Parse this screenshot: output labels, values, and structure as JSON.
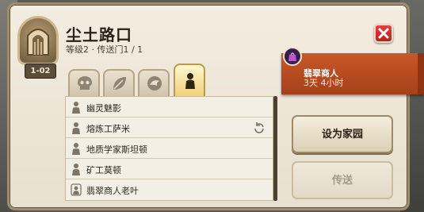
{
  "header": {
    "title": "尘土路口",
    "subtitle": "等级2 · 传送门1 / 1",
    "level_badge": "1-02"
  },
  "tabs": [
    {
      "icon": "skull-icon",
      "active": false
    },
    {
      "icon": "leaf-icon",
      "active": false
    },
    {
      "icon": "dragon-icon",
      "active": false
    },
    {
      "icon": "person-icon",
      "active": true
    }
  ],
  "npc_list": [
    {
      "name": "幽灵魅影",
      "icon": "person-icon"
    },
    {
      "name": "熔炼工萨米",
      "icon": "person-icon",
      "extra": "refresh-icon"
    },
    {
      "name": "地质学家斯坦顿",
      "icon": "person-icon"
    },
    {
      "name": "矿工莫顿",
      "icon": "person-icon"
    },
    {
      "name": "翡翠商人老叶",
      "icon": "merchant-person-icon"
    }
  ],
  "merchant": {
    "name": "翡翠商人",
    "time_left": "3天 4小时"
  },
  "buttons": {
    "set_home": "设为家园",
    "teleport": "传送"
  },
  "colors": {
    "close_button": "#c8302b",
    "merchant_banner": "#b84a20",
    "active_tab": "#efd07b"
  }
}
